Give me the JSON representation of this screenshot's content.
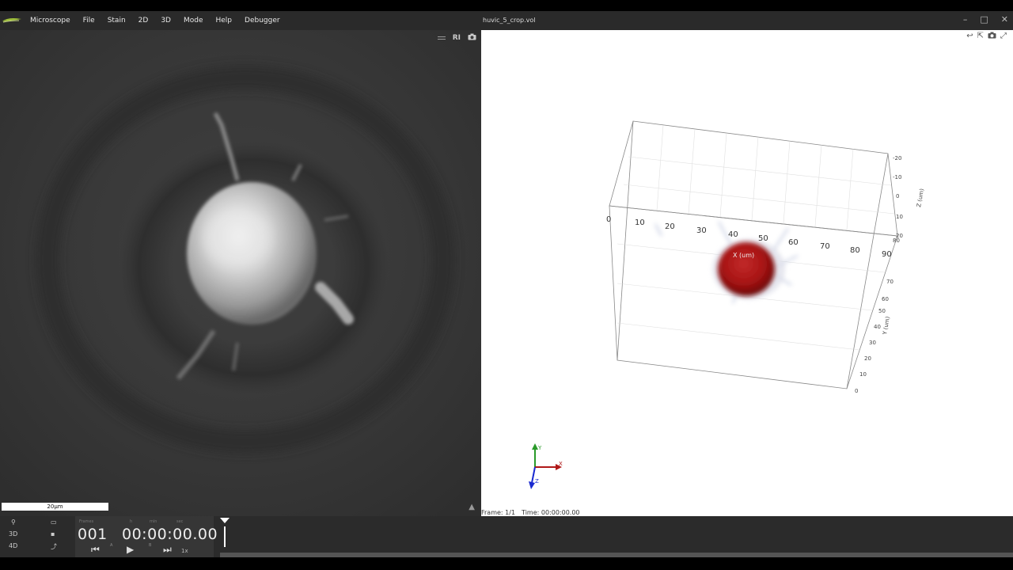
{
  "menu": {
    "items": [
      "Microscope",
      "File",
      "Stain",
      "2D",
      "3D",
      "Mode",
      "Help",
      "Debugger"
    ]
  },
  "left_view": {
    "tools": {
      "ri_label": "RI"
    },
    "scale_bar": "20µm"
  },
  "right_window": {
    "title": "huvic_5_crop.vol"
  },
  "plot3d": {
    "x_ticks": [
      "0",
      "10",
      "20",
      "30",
      "40",
      "50",
      "60",
      "70",
      "80",
      "90"
    ],
    "x_label": "X (um)",
    "y_ticks": [
      "0",
      "10",
      "20",
      "30",
      "40",
      "50",
      "60",
      "70",
      "80"
    ],
    "y_label": "Y (um)",
    "z_ticks": [
      "-20",
      "-10",
      "0",
      "10",
      "20"
    ],
    "z_label": "Z (um)",
    "axis_x": "X",
    "axis_y": "Y",
    "axis_z": "Z"
  },
  "frame_info": {
    "frame": "Frame: 1/1",
    "time": "Time: 00:00:00.00"
  },
  "player": {
    "frames_label": "Frames",
    "time_labels": [
      "h",
      "min",
      "sec"
    ],
    "frame_number": "001",
    "time_code": "00:00:00.00",
    "marker_a": "A",
    "marker_b": "B",
    "speed": "1x"
  },
  "side_icons": {
    "label_3d": "3D",
    "label_4d": "4D"
  },
  "colors": {
    "accent_red": "#b01818",
    "axis_green": "#2a9a2a",
    "axis_blue": "#1a2ad0"
  }
}
